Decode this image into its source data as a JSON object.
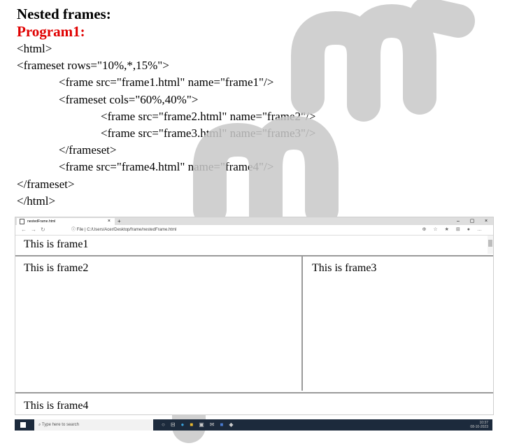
{
  "heading": "Nested frames:",
  "program_title": "Program1:",
  "code_lines": [
    {
      "text": "<html>",
      "indent": 0
    },
    {
      "text": "<frameset rows=\"10%,*,15%\">",
      "indent": 0
    },
    {
      "text": "<frame src=\"frame1.html\" name=\"frame1\"/>",
      "indent": 1
    },
    {
      "text": "<frameset cols=\"60%,40%\">",
      "indent": 1
    },
    {
      "text": "<frame src=\"frame2.html\" name=\"frame2\"/>",
      "indent": 2
    },
    {
      "text": "<frame src=\"frame3.html\" name=\"frame3\"/>",
      "indent": 2
    },
    {
      "text": "</frameset>",
      "indent": 1
    },
    {
      "text": "<frame src=\"frame4.html\" name=\"frame4\"/>",
      "indent": 1
    },
    {
      "text": "</frameset>",
      "indent": 0
    },
    {
      "text": "</html>",
      "indent": 0
    }
  ],
  "browser": {
    "tab_title": "nestedFrame.html",
    "address_prefix": "File",
    "address_url": "C:/Users/Acer/Desktop/frame/nestedFrame.html",
    "frames": {
      "frame1": "This is frame1",
      "frame2": "This is frame2",
      "frame3": "This is frame3",
      "frame4": "This is frame4"
    }
  },
  "taskbar": {
    "search_placeholder": "Type here to search",
    "time": "10:37",
    "date": "08-10-2023"
  },
  "colors": {
    "program_title": "#e00000",
    "watermark": "#c8c8c8",
    "taskbar": "#1c2a3c"
  }
}
